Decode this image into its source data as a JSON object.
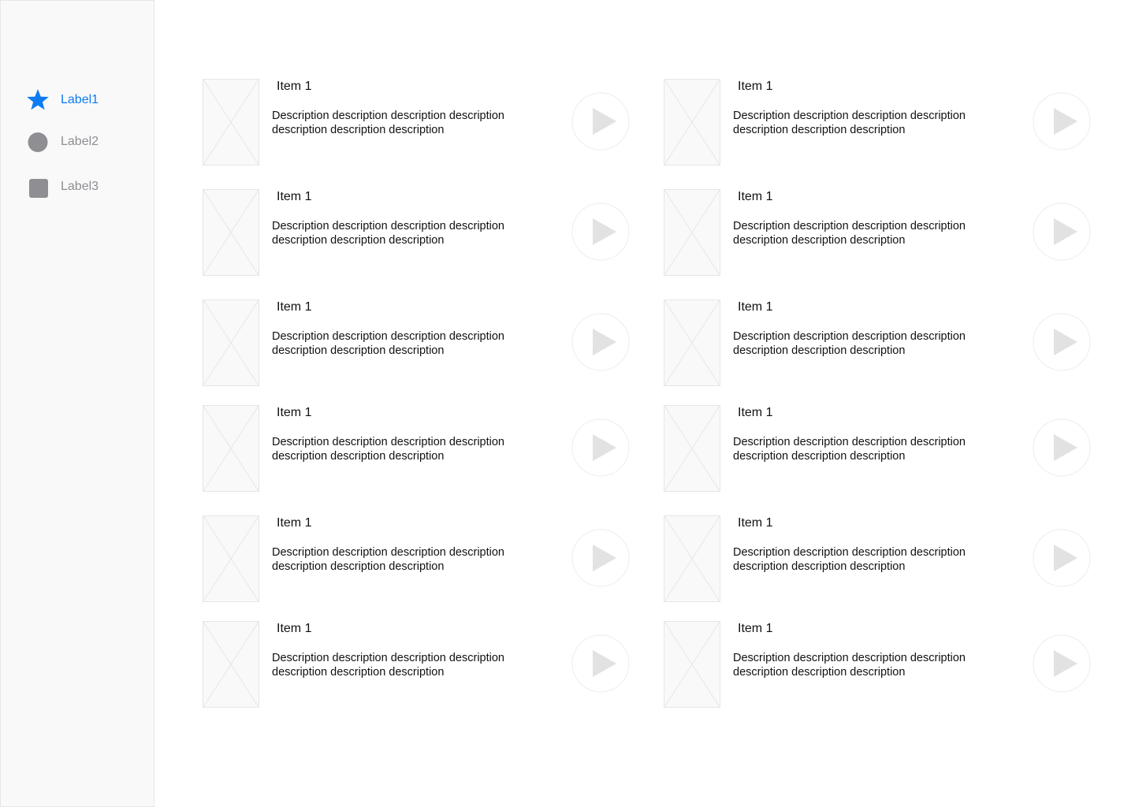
{
  "sidebar": {
    "items": [
      {
        "label": "Label1",
        "icon": "star-icon",
        "active": true
      },
      {
        "label": "Label2",
        "icon": "circle-icon",
        "active": false
      },
      {
        "label": "Label3",
        "icon": "square-icon",
        "active": false
      }
    ]
  },
  "colors": {
    "accent": "#0d7bf2",
    "inactive": "#8e8e93",
    "sidebar_bg": "#f9f9f9",
    "border": "#e6e6e6",
    "play_icon": "#e2e2e2"
  },
  "list": {
    "items": [
      {
        "title": "Item 1",
        "description": "Description description description description description description description"
      },
      {
        "title": "Item 1",
        "description": "Description description description description description description description"
      },
      {
        "title": "Item 1",
        "description": "Description description description description description description description"
      },
      {
        "title": "Item 1",
        "description": "Description description description description description description description"
      },
      {
        "title": "Item 1",
        "description": "Description description description description description description description"
      },
      {
        "title": "Item 1",
        "description": "Description description description description description description description"
      },
      {
        "title": "Item 1",
        "description": "Description description description description description description description"
      },
      {
        "title": "Item 1",
        "description": "Description description description description description description description"
      },
      {
        "title": "Item 1",
        "description": "Description description description description description description description"
      },
      {
        "title": "Item 1",
        "description": "Description description description description description description description"
      },
      {
        "title": "Item 1",
        "description": "Description description description description description description description"
      },
      {
        "title": "Item 1",
        "description": "Description description description description description description description"
      }
    ]
  }
}
